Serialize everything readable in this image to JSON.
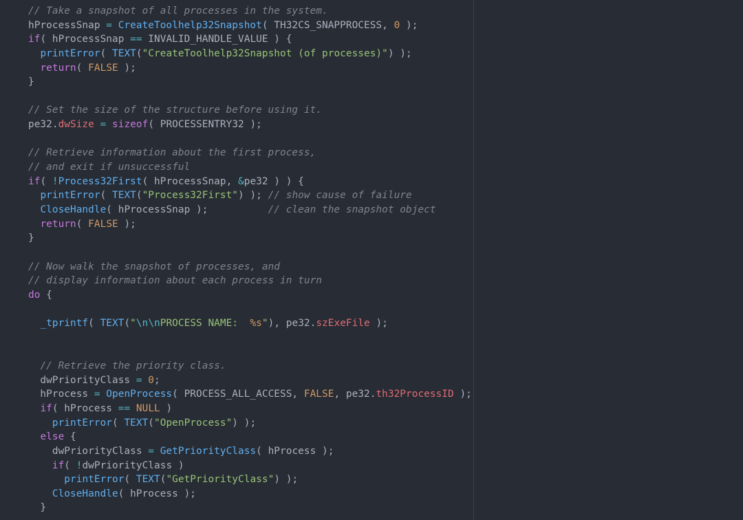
{
  "editor": {
    "theme_colors": {
      "background": "#282c34",
      "plain": "#abb2bf",
      "keyword": "#c678dd",
      "function": "#61afef",
      "string": "#98c379",
      "number": "#d19a66",
      "property": "#e06c75",
      "operator": "#56b6c2",
      "comment": "#7f848e"
    },
    "lines": [
      [
        [
          "comment",
          "// Take a snapshot of all processes in the system."
        ]
      ],
      [
        [
          "plain",
          "hProcessSnap "
        ],
        [
          "operator",
          "="
        ],
        [
          "plain",
          " "
        ],
        [
          "func",
          "CreateToolhelp32Snapshot"
        ],
        [
          "plain",
          "( TH32CS_SNAPPROCESS, "
        ],
        [
          "number",
          "0"
        ],
        [
          "plain",
          " );"
        ]
      ],
      [
        [
          "keyword",
          "if"
        ],
        [
          "plain",
          "( hProcessSnap "
        ],
        [
          "operator",
          "=="
        ],
        [
          "plain",
          " INVALID_HANDLE_VALUE ) {"
        ]
      ],
      [
        [
          "plain",
          "  "
        ],
        [
          "func",
          "printError"
        ],
        [
          "plain",
          "( "
        ],
        [
          "func",
          "TEXT"
        ],
        [
          "plain",
          "("
        ],
        [
          "string",
          "\"CreateToolhelp32Snapshot (of processes)\""
        ],
        [
          "plain",
          ") );"
        ]
      ],
      [
        [
          "plain",
          "  "
        ],
        [
          "keyword",
          "return"
        ],
        [
          "plain",
          "( "
        ],
        [
          "const",
          "FALSE"
        ],
        [
          "plain",
          " );"
        ]
      ],
      [
        [
          "plain",
          "}"
        ]
      ],
      [],
      [
        [
          "comment",
          "// Set the size of the structure before using it."
        ]
      ],
      [
        [
          "plain",
          "pe32."
        ],
        [
          "property",
          "dwSize"
        ],
        [
          "plain",
          " "
        ],
        [
          "operator",
          "="
        ],
        [
          "plain",
          " "
        ],
        [
          "keyword",
          "sizeof"
        ],
        [
          "plain",
          "( PROCESSENTRY32 );"
        ]
      ],
      [],
      [
        [
          "comment",
          "// Retrieve information about the first process,"
        ]
      ],
      [
        [
          "comment",
          "// and exit if unsuccessful"
        ]
      ],
      [
        [
          "keyword",
          "if"
        ],
        [
          "plain",
          "( "
        ],
        [
          "operator",
          "!"
        ],
        [
          "func",
          "Process32First"
        ],
        [
          "plain",
          "( hProcessSnap, "
        ],
        [
          "operator",
          "&"
        ],
        [
          "plain",
          "pe32 ) ) {"
        ]
      ],
      [
        [
          "plain",
          "  "
        ],
        [
          "func",
          "printError"
        ],
        [
          "plain",
          "( "
        ],
        [
          "func",
          "TEXT"
        ],
        [
          "plain",
          "("
        ],
        [
          "string",
          "\"Process32First\""
        ],
        [
          "plain",
          ") ); "
        ],
        [
          "comment",
          "// show cause of failure"
        ]
      ],
      [
        [
          "plain",
          "  "
        ],
        [
          "func",
          "CloseHandle"
        ],
        [
          "plain",
          "( hProcessSnap );          "
        ],
        [
          "comment",
          "// clean the snapshot object"
        ]
      ],
      [
        [
          "plain",
          "  "
        ],
        [
          "keyword",
          "return"
        ],
        [
          "plain",
          "( "
        ],
        [
          "const",
          "FALSE"
        ],
        [
          "plain",
          " );"
        ]
      ],
      [
        [
          "plain",
          "}"
        ]
      ],
      [],
      [
        [
          "comment",
          "// Now walk the snapshot of processes, and"
        ]
      ],
      [
        [
          "comment",
          "// display information about each process in turn"
        ]
      ],
      [
        [
          "keyword",
          "do"
        ],
        [
          "plain",
          " {"
        ]
      ],
      [],
      [
        [
          "plain",
          "  "
        ],
        [
          "func",
          "_tprintf"
        ],
        [
          "plain",
          "( "
        ],
        [
          "func",
          "TEXT"
        ],
        [
          "plain",
          "("
        ],
        [
          "string",
          "\""
        ],
        [
          "escape",
          "\\n\\n"
        ],
        [
          "string",
          "PROCESS NAME:  "
        ],
        [
          "number",
          "%s"
        ],
        [
          "string",
          "\""
        ],
        [
          "plain",
          "), pe32."
        ],
        [
          "property",
          "szExeFile"
        ],
        [
          "plain",
          " );"
        ]
      ],
      [],
      [],
      [
        [
          "plain",
          "  "
        ],
        [
          "comment",
          "// Retrieve the priority class."
        ]
      ],
      [
        [
          "plain",
          "  dwPriorityClass "
        ],
        [
          "operator",
          "="
        ],
        [
          "plain",
          " "
        ],
        [
          "number",
          "0"
        ],
        [
          "plain",
          ";"
        ]
      ],
      [
        [
          "plain",
          "  hProcess "
        ],
        [
          "operator",
          "="
        ],
        [
          "plain",
          " "
        ],
        [
          "func",
          "OpenProcess"
        ],
        [
          "plain",
          "( PROCESS_ALL_ACCESS, "
        ],
        [
          "const",
          "FALSE"
        ],
        [
          "plain",
          ", pe32."
        ],
        [
          "property",
          "th32ProcessID"
        ],
        [
          "plain",
          " );"
        ]
      ],
      [
        [
          "plain",
          "  "
        ],
        [
          "keyword",
          "if"
        ],
        [
          "plain",
          "( hProcess "
        ],
        [
          "operator",
          "=="
        ],
        [
          "plain",
          " "
        ],
        [
          "const",
          "NULL"
        ],
        [
          "plain",
          " )"
        ]
      ],
      [
        [
          "plain",
          "    "
        ],
        [
          "func",
          "printError"
        ],
        [
          "plain",
          "( "
        ],
        [
          "func",
          "TEXT"
        ],
        [
          "plain",
          "("
        ],
        [
          "string",
          "\"OpenProcess\""
        ],
        [
          "plain",
          ") );"
        ]
      ],
      [
        [
          "plain",
          "  "
        ],
        [
          "keyword",
          "else"
        ],
        [
          "plain",
          " {"
        ]
      ],
      [
        [
          "plain",
          "    dwPriorityClass "
        ],
        [
          "operator",
          "="
        ],
        [
          "plain",
          " "
        ],
        [
          "func",
          "GetPriorityClass"
        ],
        [
          "plain",
          "( hProcess );"
        ]
      ],
      [
        [
          "plain",
          "    "
        ],
        [
          "keyword",
          "if"
        ],
        [
          "plain",
          "( "
        ],
        [
          "operator",
          "!"
        ],
        [
          "plain",
          "dwPriorityClass )"
        ]
      ],
      [
        [
          "plain",
          "      "
        ],
        [
          "func",
          "printError"
        ],
        [
          "plain",
          "( "
        ],
        [
          "func",
          "TEXT"
        ],
        [
          "plain",
          "("
        ],
        [
          "string",
          "\"GetPriorityClass\""
        ],
        [
          "plain",
          ") );"
        ]
      ],
      [
        [
          "plain",
          "    "
        ],
        [
          "func",
          "CloseHandle"
        ],
        [
          "plain",
          "( hProcess );"
        ]
      ],
      [
        [
          "plain",
          "  }"
        ]
      ]
    ]
  }
}
